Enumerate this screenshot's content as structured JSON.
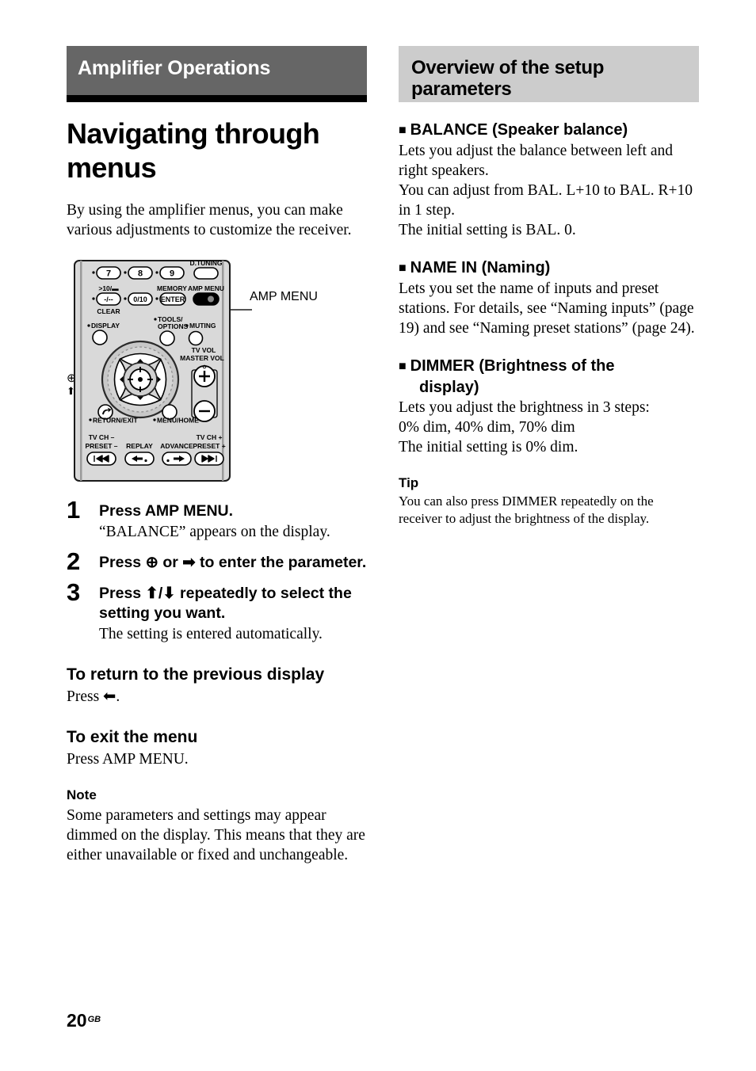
{
  "chapter": {
    "banner_title": "Amplifier Operations"
  },
  "page_title": "Navigating through menus",
  "intro": "By using the amplifier menus, you can make various adjustments to customize the receiver.",
  "figure": {
    "callout_amp_menu": "AMP MENU",
    "callout_enter_label": "⊕ ,",
    "callout_arrows_label": "⬆/⬇/⬅/➡",
    "remote_labels": {
      "btn7": "7",
      "btn8": "8",
      "btn9": "9",
      "d_tuning": "D.TUNING",
      "ten_key_top": ">10/▬",
      "ten_key": "-/--",
      "clear": "CLEAR",
      "zero_ten": "0/10",
      "memory": "MEMORY",
      "enter": "ENTER",
      "amp_menu": "AMP MENU",
      "display": "DISPLAY",
      "tools": "TOOLS/",
      "options": "OPTIONS",
      "muting": "MUTING",
      "tv_vol": "TV VOL",
      "master_vol": "MASTER VOL",
      "return_exit": "RETURN/EXIT",
      "menu_home": "MENU/HOME",
      "tv_ch_minus": "TV CH –",
      "preset_minus": "PRESET –",
      "replay": "REPLAY",
      "advance": "ADVANCE",
      "tv_ch_plus": "TV CH +",
      "preset_plus": "PRESET +",
      "vol_plus": "+",
      "vol_minus": "–"
    }
  },
  "steps": [
    {
      "num": "1",
      "head": "Press AMP MENU.",
      "body": "“BALANCE” appears on the display."
    },
    {
      "num": "2",
      "head_pre": "Press ",
      "head_glyph": "⊕",
      "head_post": " or ➡ to enter the parameter.",
      "body": ""
    },
    {
      "num": "3",
      "head": "Press ⬆/⬇ repeatedly to select the setting you want.",
      "body": "The setting is entered automatically."
    }
  ],
  "sections_left": [
    {
      "head": "To return to the previous display",
      "body": "Press ⬅."
    },
    {
      "head": "To exit the menu",
      "body": "Press AMP MENU."
    },
    {
      "head": "Note",
      "body": "Some parameters and settings may appear dimmed on the display. This means that they are either unavailable or fixed and unchangeable."
    }
  ],
  "right": {
    "banner_title": "Overview of the setup parameters",
    "params": [
      {
        "square": "■",
        "head": "BALANCE (Speaker balance)",
        "head_cont": "",
        "body": "Lets you adjust the balance between left and right speakers.\nYou can adjust from BAL. L+10 to BAL. R+10 in 1 step.\nThe initial setting is BAL. 0."
      },
      {
        "square": "■",
        "head": "NAME IN (Naming)",
        "head_cont": "",
        "body": "Lets you set the name of inputs and preset stations. For details, see “Naming inputs” (page 19) and see “Naming preset stations” (page 24)."
      },
      {
        "square": "■",
        "head": "DIMMER (Brightness of the",
        "head_cont": "display)",
        "body": "Lets you adjust the brightness in 3 steps:\n0% dim, 40% dim, 70% dim\nThe initial setting is 0% dim."
      }
    ],
    "tip_head": "Tip",
    "tip_body": "You can also press DIMMER repeatedly on the receiver to adjust the brightness of the display."
  },
  "footer": {
    "page_number": "20",
    "page_suffix": "GB"
  },
  "colors": {
    "chapter_banner_bg": "#666666",
    "chapter_rule": "#000000",
    "section_banner_bg": "#cccccc",
    "remote_body": "#d9d9d9"
  }
}
